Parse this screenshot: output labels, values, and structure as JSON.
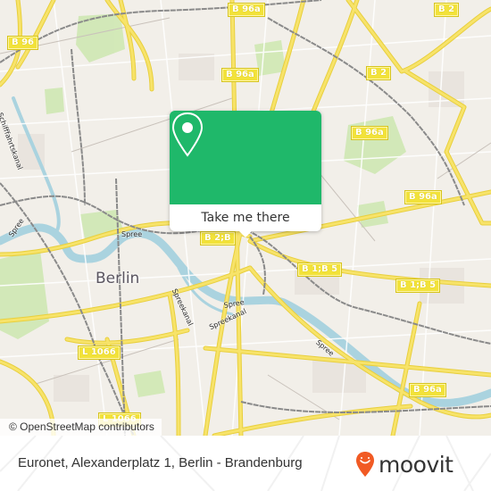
{
  "map": {
    "attribution": "© OpenStreetMap contributors",
    "city_label": "Berlin",
    "water_labels": [
      {
        "text": "Spree"
      },
      {
        "text": "Spree"
      },
      {
        "text": "Spree"
      },
      {
        "text": "Spree"
      },
      {
        "text": "Spreekanal"
      },
      {
        "text": "Spreekanal"
      },
      {
        "text": "Schifffahrtskanal"
      }
    ],
    "road_shields": [
      {
        "text": "B 96"
      },
      {
        "text": "B 96a"
      },
      {
        "text": "B 96a"
      },
      {
        "text": "B 2"
      },
      {
        "text": "B 2"
      },
      {
        "text": "B 96a"
      },
      {
        "text": "B 96a"
      },
      {
        "text": "B 2;B"
      },
      {
        "text": "B 1;B 5"
      },
      {
        "text": "B 1;B 5"
      },
      {
        "text": "B 96a"
      },
      {
        "text": "L 1066"
      },
      {
        "text": "L 1066"
      }
    ],
    "colors": {
      "land": "#f2efe9",
      "water": "#aad3df",
      "park": "#c8e6a8",
      "major_road": "#f7e36a",
      "rail": "#8a8a8a"
    }
  },
  "popup": {
    "icon": "map-pin-icon",
    "button_label": "Take me there",
    "accent": "#1fb86a"
  },
  "footer": {
    "address": "Euronet, Alexanderplatz 1, Berlin - Brandenburg",
    "brand": "moovit",
    "brand_color": "#f15a24"
  }
}
